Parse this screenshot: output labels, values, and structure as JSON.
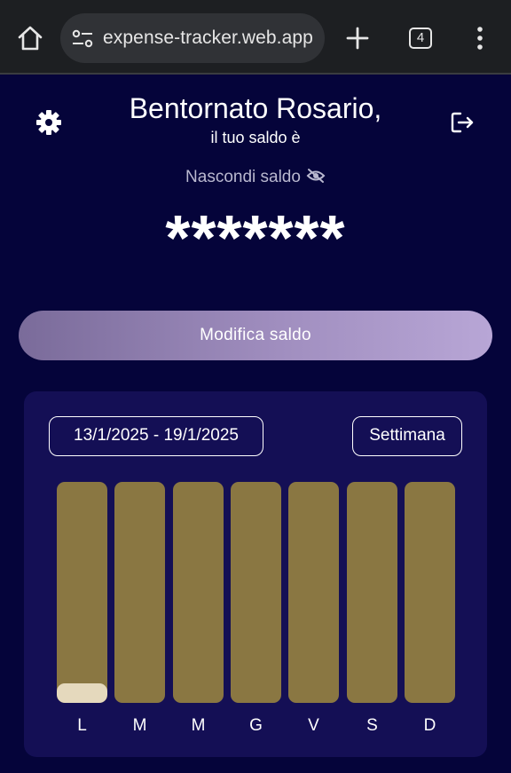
{
  "browser": {
    "url": "expense-tracker.web.app",
    "tab_count": "4",
    "chrome_color": "#1d1f22"
  },
  "header": {
    "greeting": "Bentornato Rosario,",
    "subtitle": "il tuo saldo è",
    "hide_balance_label": "Nascondi saldo",
    "balance_masked": "*******"
  },
  "actions": {
    "edit_balance_label": "Modifica saldo"
  },
  "chart": {
    "date_range_label": "13/1/2025 - 19/1/2025",
    "period_label": "Settimana"
  },
  "chart_data": {
    "type": "bar",
    "categories": [
      "L",
      "M",
      "M",
      "G",
      "V",
      "S",
      "D"
    ],
    "values": [
      0.09,
      0,
      0,
      0,
      0,
      0,
      0
    ],
    "ylim": [
      0,
      1
    ],
    "track_color": "#8a7742",
    "fill_color": "#e5d9bd"
  },
  "colors": {
    "background": "#05043a",
    "card": "#140f55",
    "button_gradient_start": "#7a6b9a",
    "button_gradient_end": "#b8a6d6"
  }
}
